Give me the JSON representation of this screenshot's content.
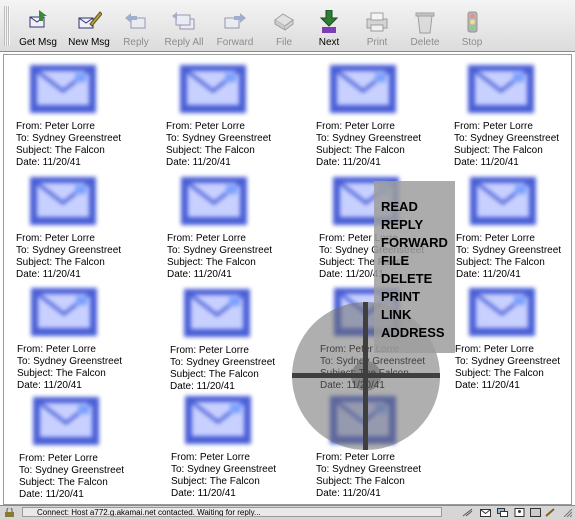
{
  "toolbar": {
    "buttons": [
      {
        "label": "Get Msg",
        "icon": "get-msg-icon",
        "enabled": true
      },
      {
        "label": "New Msg",
        "icon": "new-msg-icon",
        "enabled": true
      },
      {
        "label": "Reply",
        "icon": "reply-icon",
        "enabled": false
      },
      {
        "label": "Reply All",
        "icon": "reply-all-icon",
        "enabled": false
      },
      {
        "label": "Forward",
        "icon": "forward-icon",
        "enabled": false
      },
      {
        "label": "File",
        "icon": "file-icon",
        "enabled": false
      },
      {
        "label": "Next",
        "icon": "next-icon",
        "enabled": true
      },
      {
        "label": "Print",
        "icon": "print-icon",
        "enabled": false
      },
      {
        "label": "Delete",
        "icon": "delete-icon",
        "enabled": false
      },
      {
        "label": "Stop",
        "icon": "stop-icon",
        "enabled": false
      }
    ]
  },
  "message": {
    "from": "From:  Peter Lorre",
    "to": "To:  Sydney Greenstreet",
    "subject": "Subject:  The Falcon",
    "date": "Date:  11/20/41"
  },
  "message_count": 15,
  "pie_menu": {
    "items": [
      "READ",
      "REPLY",
      "FORWARD",
      "FILE",
      "DELETE",
      "PRINT",
      "LINK",
      "ADDRESS"
    ]
  },
  "status_bar": {
    "text": "Connect: Host a772.g.akamai.net contacted. Waiting for reply..."
  },
  "colors": {
    "envelope_blue": "#4a5fd6",
    "envelope_light": "#c8d0ff",
    "menu_background": "#9e9e9e",
    "pie_overlay": "#6e6e6e"
  }
}
